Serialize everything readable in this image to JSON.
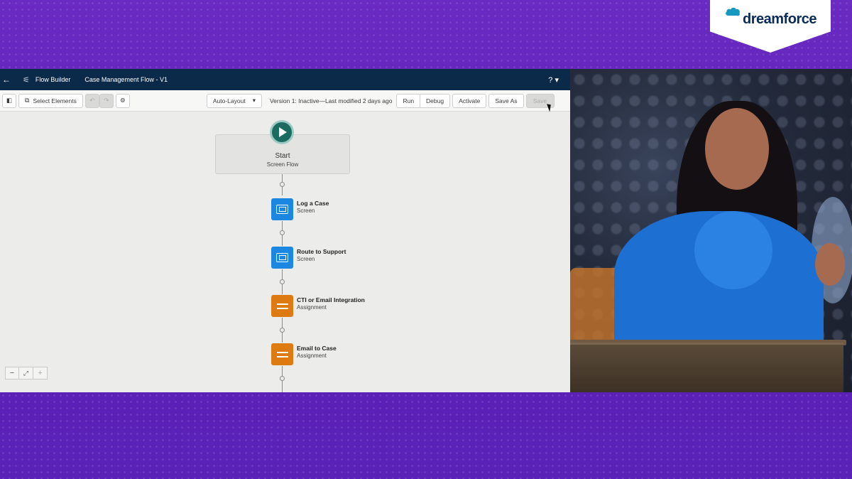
{
  "event": {
    "brand": "dreamforce"
  },
  "appbar": {
    "builder_name": "Flow Builder",
    "flow_name": "Case Management Flow - V1",
    "help": "? ▾"
  },
  "toolbar": {
    "select_elements": "Select Elements",
    "layout_mode": "Auto-Layout",
    "version_text": "Version 1: Inactive—Last modified 2 days ago",
    "run": "Run",
    "debug": "Debug",
    "activate": "Activate",
    "save_as": "Save As",
    "save": "Save"
  },
  "canvas": {
    "start": {
      "title": "Start",
      "subtitle": "Screen Flow"
    },
    "elements": [
      {
        "label": "Log a Case",
        "type": "Screen"
      },
      {
        "label": "Route to Support",
        "type": "Screen"
      },
      {
        "label": "CTI or Email Integration",
        "type": "Assignment"
      },
      {
        "label": "Email to Case",
        "type": "Assignment"
      }
    ],
    "zoom": {
      "out": "−",
      "fit": "⤢",
      "in": "+"
    }
  },
  "colors": {
    "background_purple": "#5a1fb4",
    "appbar_navy": "#0b2a4a",
    "screen_blue": "#1b87e0",
    "assignment_orange": "#dd7a12",
    "start_teal": "#1c6b61",
    "speaker_top_blue": "#1d6fd1"
  }
}
